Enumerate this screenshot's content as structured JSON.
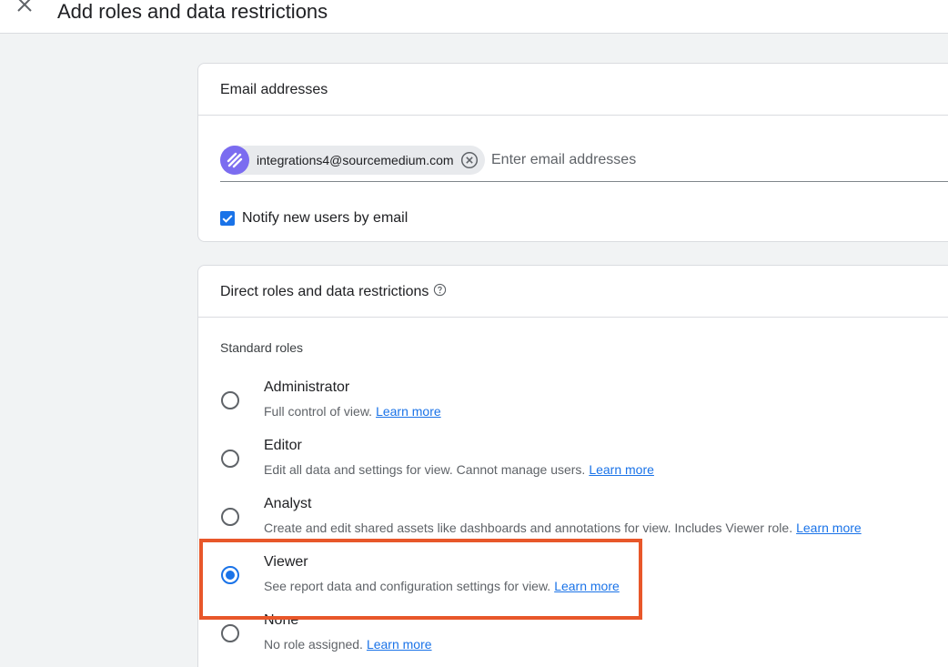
{
  "header": {
    "title": "Add roles and data restrictions",
    "close_icon": "close-icon"
  },
  "email_section": {
    "title": "Email addresses",
    "chip": {
      "email": "integrations4@sourcemedium.com",
      "avatar_icon": "sourcemedium-logo-icon",
      "avatar_color": "#7b6cf0",
      "remove_icon": "cancel-circle-icon"
    },
    "input_placeholder": "Enter email addresses",
    "notify": {
      "label": "Notify new users by email",
      "checked": true
    }
  },
  "roles_section": {
    "title": "Direct roles and data restrictions",
    "help_icon": "help-circle-icon",
    "standard_roles_label": "Standard roles",
    "roles": [
      {
        "name": "Administrator",
        "description": "Full control of view.",
        "link": "Learn more",
        "selected": false
      },
      {
        "name": "Editor",
        "description": "Edit all data and settings for view. Cannot manage users.",
        "link": "Learn more",
        "selected": false
      },
      {
        "name": "Analyst",
        "description": "Create and edit shared assets like dashboards and annotations for view. Includes Viewer role.",
        "link": "Learn more",
        "selected": false
      },
      {
        "name": "Viewer",
        "description": "See report data and configuration settings for view.",
        "link": "Learn more",
        "selected": true
      },
      {
        "name": "None",
        "description": "No role assigned.",
        "link": "Learn more",
        "selected": false
      }
    ]
  },
  "colors": {
    "accent": "#1a73e8",
    "highlight": "#e8572a"
  }
}
